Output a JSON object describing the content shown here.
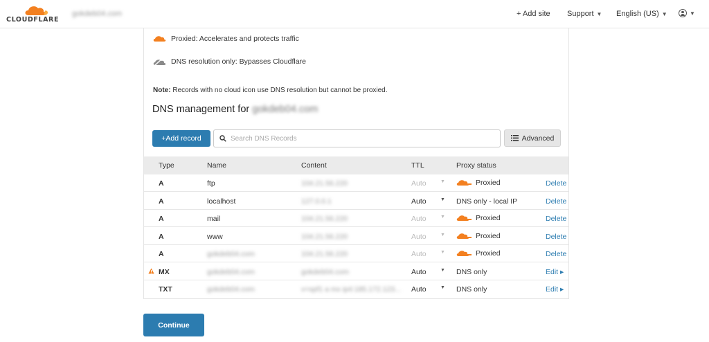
{
  "header": {
    "logo_text": "CLOUDFLARE",
    "account_name": "gokdeb04.com",
    "add_site": "+ Add site",
    "support": "Support",
    "language": "English (US)"
  },
  "legend": {
    "proxied": "Proxied: Accelerates and protects traffic",
    "dns_only": "DNS resolution only: Bypasses Cloudflare"
  },
  "note": {
    "label": "Note:",
    "text": " Records with no cloud icon use DNS resolution but cannot be proxied."
  },
  "dns": {
    "heading": "DNS management for ",
    "domain": "gokdeb04.com",
    "add_record": "+Add record",
    "search_placeholder": "Search DNS Records",
    "advanced": "Advanced"
  },
  "table": {
    "headers": {
      "type": "Type",
      "name": "Name",
      "content": "Content",
      "ttl": "TTL",
      "proxy": "Proxy status"
    },
    "rows": [
      {
        "type": "A",
        "name": "ftp",
        "content": "104.21.56.220",
        "ttl": "Auto",
        "proxy": "Proxied",
        "action": "Delete"
      },
      {
        "type": "A",
        "name": "localhost",
        "content": "127.0.0.1",
        "ttl": "Auto",
        "proxy": "DNS only - local IP",
        "action": "Delete"
      },
      {
        "type": "A",
        "name": "mail",
        "content": "104.21.56.220",
        "ttl": "Auto",
        "proxy": "Proxied",
        "action": "Delete"
      },
      {
        "type": "A",
        "name": "www",
        "content": "104.21.56.220",
        "ttl": "Auto",
        "proxy": "Proxied",
        "action": "Delete"
      },
      {
        "type": "A",
        "name": "gokdeb04.com",
        "content": "104.21.56.220",
        "ttl": "Auto",
        "proxy": "Proxied",
        "action": "Delete"
      },
      {
        "type": "MX",
        "name": "gokdeb04.com",
        "content": "gokdeb04.com",
        "ttl": "Auto",
        "proxy": "DNS only",
        "action": "Edit ▸"
      },
      {
        "type": "TXT",
        "name": "gokdeb04.com",
        "content": "v=spf1 a mx ip4:185.172.123...",
        "ttl": "Auto",
        "proxy": "DNS only",
        "action": "Edit ▸"
      }
    ]
  },
  "continue_label": "Continue",
  "colors": {
    "brand": "#f38020",
    "link": "#2c7cb0",
    "warning": "#f38020"
  }
}
